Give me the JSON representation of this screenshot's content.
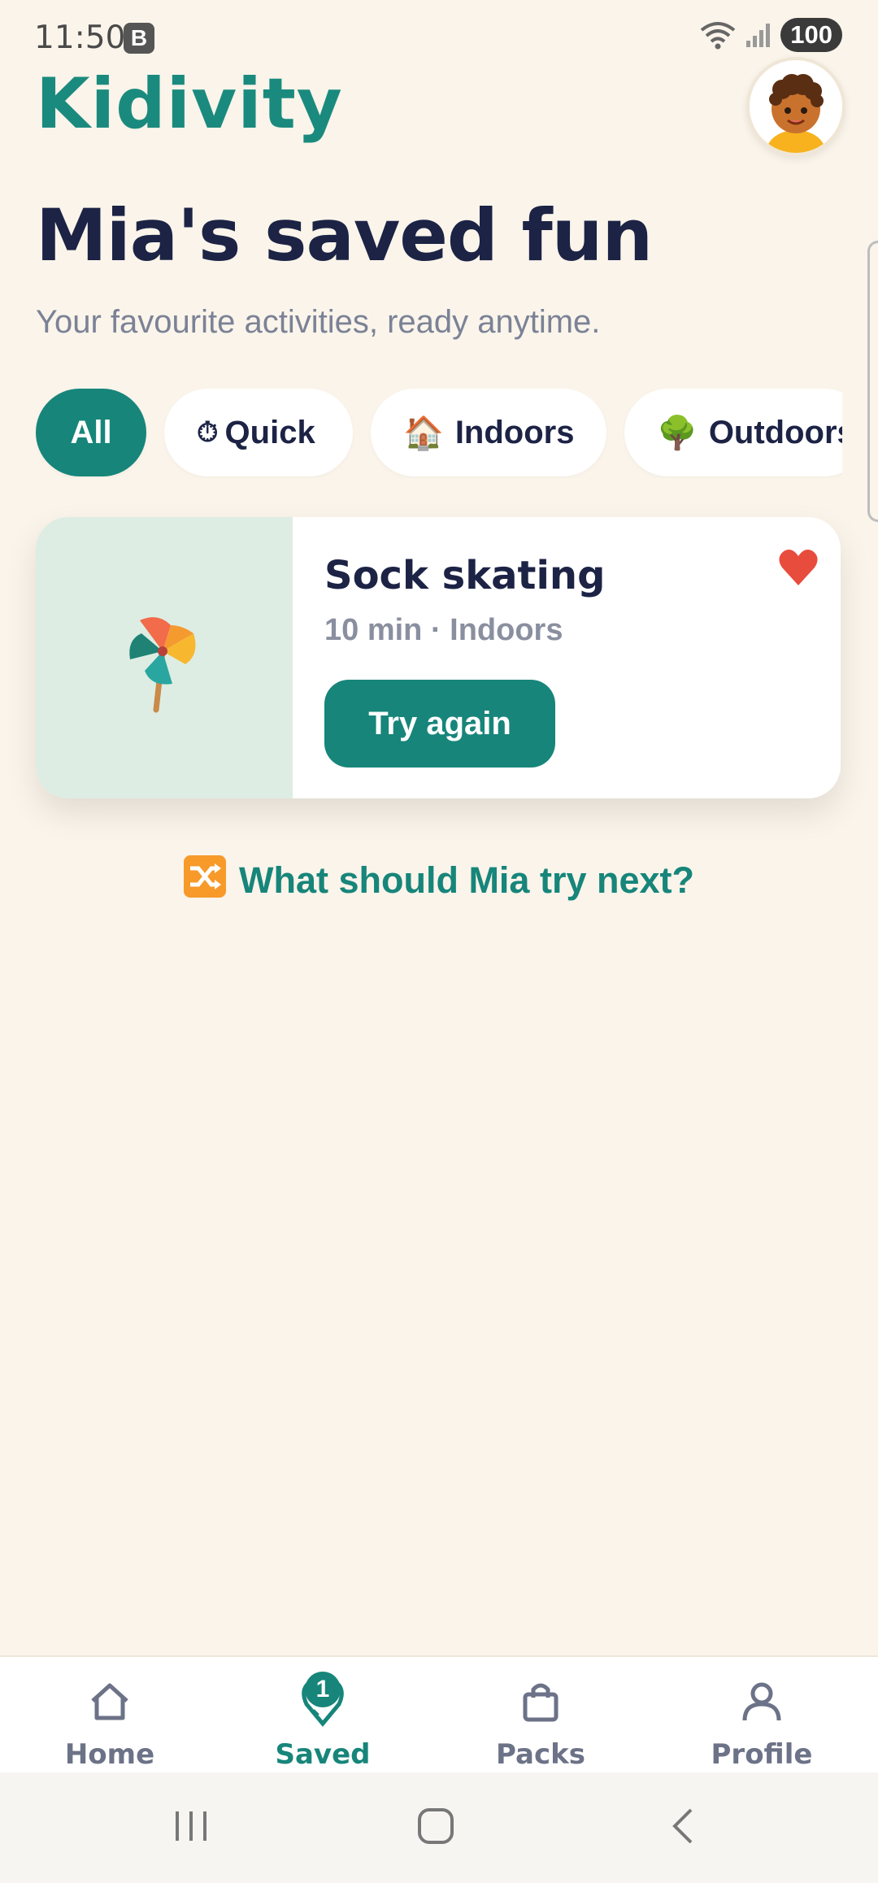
{
  "status": {
    "time": "11:50",
    "notification_letter": "B",
    "battery": "100"
  },
  "app": {
    "name": "Kidivity"
  },
  "page": {
    "title": "Mia's saved fun",
    "subtitle": "Your favourite activities, ready anytime."
  },
  "filters": [
    {
      "label": "All",
      "emoji": "",
      "active": true
    },
    {
      "label": "Quick",
      "emoji": "⏱",
      "active": false
    },
    {
      "label": "Indoors",
      "emoji": "🏠",
      "active": false
    },
    {
      "label": "Outdoors",
      "emoji": "🌳",
      "active": false
    }
  ],
  "saved_items": [
    {
      "title": "Sock skating",
      "meta": "10 min · Indoors",
      "action": "Try again",
      "favorited": true,
      "icon": "pinwheel-icon"
    }
  ],
  "suggestion": {
    "text": "What should Mia try next?",
    "icon": "shuffle-icon"
  },
  "bottom_nav": {
    "items": [
      {
        "label": "Home",
        "icon": "home-icon",
        "active": false
      },
      {
        "label": "Saved",
        "icon": "saved-pin-icon",
        "active": true,
        "badge": "1"
      },
      {
        "label": "Packs",
        "icon": "shopping-bag-icon",
        "active": false
      },
      {
        "label": "Profile",
        "icon": "person-icon",
        "active": false
      }
    ]
  },
  "colors": {
    "accent": "#17857A",
    "background": "#FAF4EA",
    "heart": "#E84C3D"
  }
}
